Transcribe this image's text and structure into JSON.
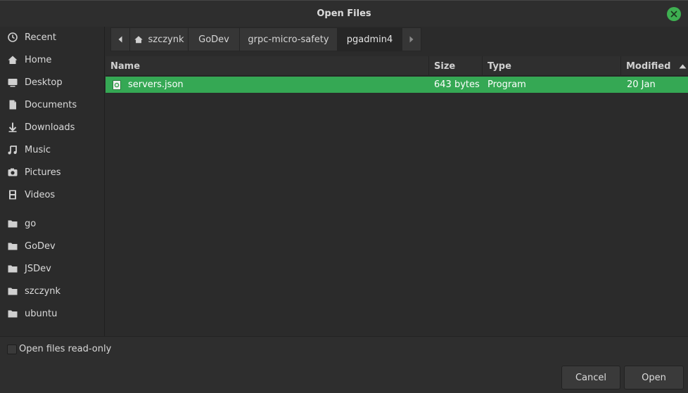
{
  "window": {
    "title": "Open Files"
  },
  "sidebar": {
    "places": [
      {
        "label": "Recent",
        "icon": "recent-icon"
      },
      {
        "label": "Home",
        "icon": "home-icon"
      },
      {
        "label": "Desktop",
        "icon": "desktop-icon"
      },
      {
        "label": "Documents",
        "icon": "documents-icon"
      },
      {
        "label": "Downloads",
        "icon": "downloads-icon"
      },
      {
        "label": "Music",
        "icon": "music-icon"
      },
      {
        "label": "Pictures",
        "icon": "pictures-icon"
      },
      {
        "label": "Videos",
        "icon": "videos-icon"
      }
    ],
    "bookmarks": [
      {
        "label": "go",
        "icon": "folder-icon"
      },
      {
        "label": "GoDev",
        "icon": "folder-icon"
      },
      {
        "label": "JSDev",
        "icon": "folder-icon"
      },
      {
        "label": "szczynk",
        "icon": "folder-icon"
      },
      {
        "label": "ubuntu",
        "icon": "folder-icon"
      }
    ]
  },
  "pathbar": {
    "crumbs": [
      "szczynk",
      "GoDev",
      "grpc-micro-safety",
      "pgadmin4"
    ],
    "active_index": 3
  },
  "filelist": {
    "columns": {
      "name": "Name",
      "size": "Size",
      "type": "Type",
      "modified": "Modified"
    },
    "sort_column": "modified",
    "rows": [
      {
        "name": "servers.json",
        "size": "643 bytes",
        "type": "Program",
        "modified": "20 Jan",
        "selected": true
      }
    ]
  },
  "footer": {
    "readonly_label": "Open files read-only",
    "readonly_checked": false,
    "cancel_label": "Cancel",
    "open_label": "Open"
  },
  "colors": {
    "accent": "#35a854",
    "background": "#2b2b2b"
  }
}
